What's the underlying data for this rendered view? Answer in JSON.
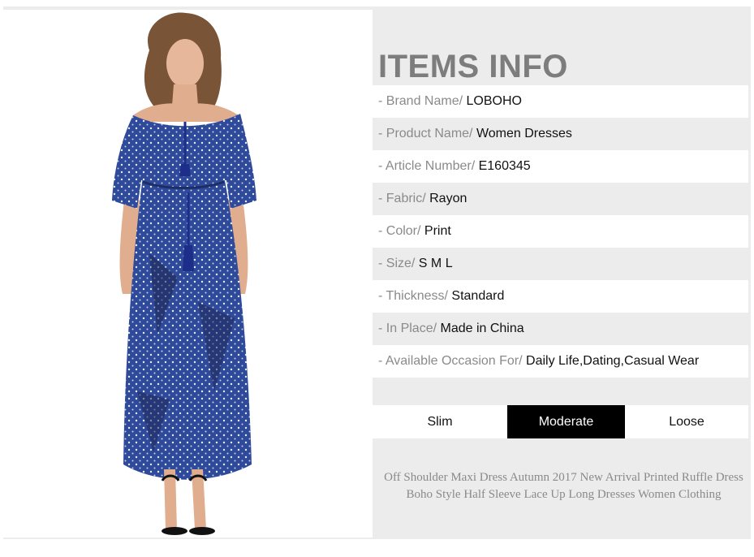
{
  "info": {
    "title": "ITEMS INFO",
    "rows": [
      {
        "label": "- Brand Name/",
        "value": "LOBOHO"
      },
      {
        "label": "- Product Name/",
        "value": "Women Dresses"
      },
      {
        "label": "- Article Number/",
        "value": "E160345"
      },
      {
        "label": "- Fabric/",
        "value": "Rayon"
      },
      {
        "label": "- Color/",
        "value": "Print"
      },
      {
        "label": "- Size/",
        "value": "S M L"
      },
      {
        "label": "- Thickness/",
        "value": "Standard"
      },
      {
        "label": "- In Place/",
        "value": "Made in China"
      },
      {
        "label": "- Available Occasion For/",
        "value": "Daily Life,Dating,Casual Wear"
      }
    ]
  },
  "fit": {
    "options": [
      "Slim",
      "Moderate",
      "Loose"
    ],
    "selected": "Moderate"
  },
  "description": {
    "line1": "Off Shoulder Maxi Dress Autumn 2017 New Arrival Printed Ruffle Dress",
    "line2": "Boho Style Half Sleeve Lace Up Long Dresses Women Clothing"
  },
  "colors": {
    "title_gray": "#7d7d7d",
    "panel_gray": "#ececec",
    "active_fit": "#000000",
    "dress_blue": "#2f4a9a"
  }
}
